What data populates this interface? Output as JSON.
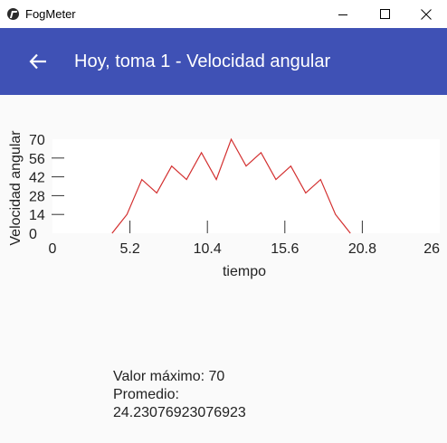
{
  "window": {
    "title": "FogMeter"
  },
  "appbar": {
    "title": "Hoy, toma 1 - Velocidad angular"
  },
  "colors": {
    "primary": "#3f51b5",
    "line": "#d32f2f",
    "background": "#fafafa"
  },
  "icons": {
    "back": "arrow-left-icon",
    "app": "fogmeter-icon"
  },
  "chart_data": {
    "type": "line",
    "xlabel": "tiempo",
    "ylabel": "Velocidad angular",
    "xlim": [
      0,
      26
    ],
    "ylim": [
      0,
      70
    ],
    "x_ticks": [
      "0",
      "5.2",
      "10.4",
      "15.6",
      "20.8",
      "26"
    ],
    "y_ticks": [
      "0",
      "14",
      "28",
      "42",
      "56",
      "70"
    ],
    "series": [
      {
        "x": [
          4.0,
          5.0,
          6.0,
          7.0,
          8.0,
          9.0,
          10.0,
          11.0,
          12.0,
          13.0,
          14.0,
          15.0,
          16.0,
          17.0,
          18.0,
          19.0,
          20.0
        ],
        "y": [
          0,
          14,
          40,
          30,
          50,
          40,
          60,
          40,
          70,
          50,
          60,
          40,
          50,
          30,
          40,
          14,
          0
        ]
      }
    ]
  },
  "stats": {
    "max_line": "Valor máximo: 70",
    "avg_label": "Promedio:",
    "avg_value": "24.23076923076923"
  }
}
